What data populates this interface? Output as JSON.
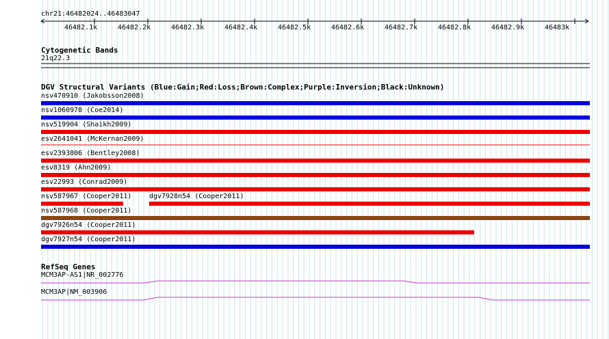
{
  "ruler": {
    "coordinates": "chr21:46482024..46483047",
    "ticks": [
      "46482.1k",
      "46482.2k",
      "46482.3k",
      "46482.4k",
      "46482.5k",
      "46482.6k",
      "46482.7k",
      "46482.8k",
      "46482.9k",
      "46483k"
    ]
  },
  "tracks": {
    "cytoband": {
      "title": "Cytogenetic Bands",
      "band": "21q22.3"
    },
    "dgv": {
      "title": "DGV Structural Variants (Blue:Gain;Red:Loss;Brown:Complex;Purple:Inversion;Black:Unknown)",
      "features": [
        {
          "label": "nsv470910 (Jakobsson2008)",
          "color": "#0000e0"
        },
        {
          "label": "nsv1060978 (Coe2014)",
          "color": "#0000e0"
        },
        {
          "label": "nsv519904 (Shaikh2009)",
          "color": "#ee0000"
        },
        {
          "label": "esv2641041 (McKernan2009)",
          "color": "#ee0000"
        },
        {
          "label": "esv2393806 (Bentley2008)",
          "color": "#ee0000"
        },
        {
          "label": "esv8319 (Ahn2009)",
          "color": "#ee0000"
        },
        {
          "label": "esv22993 (Conrad2009)",
          "color": "#ee0000"
        },
        {
          "label": "nsv587967 (Cooper2011)",
          "color": "#ee0000"
        },
        {
          "label": "dgv7928n54 (Cooper2011)",
          "color": "#ee0000"
        },
        {
          "label": "nsv587968 (Cooper2011)",
          "color": "#8b4513"
        },
        {
          "label": "dgv7926n54 (Cooper2011)",
          "color": "#ee0000"
        },
        {
          "label": "dgv7927n54 (Cooper2011)",
          "color": "#0000e0"
        }
      ]
    },
    "refseq": {
      "title": "RefSeq Genes",
      "genes": [
        {
          "label": "MCM3AP-AS1|NR_002776",
          "color": "#cc33cc"
        },
        {
          "label": "MCM3AP|NM_003906",
          "color": "#cc33cc"
        }
      ]
    }
  }
}
